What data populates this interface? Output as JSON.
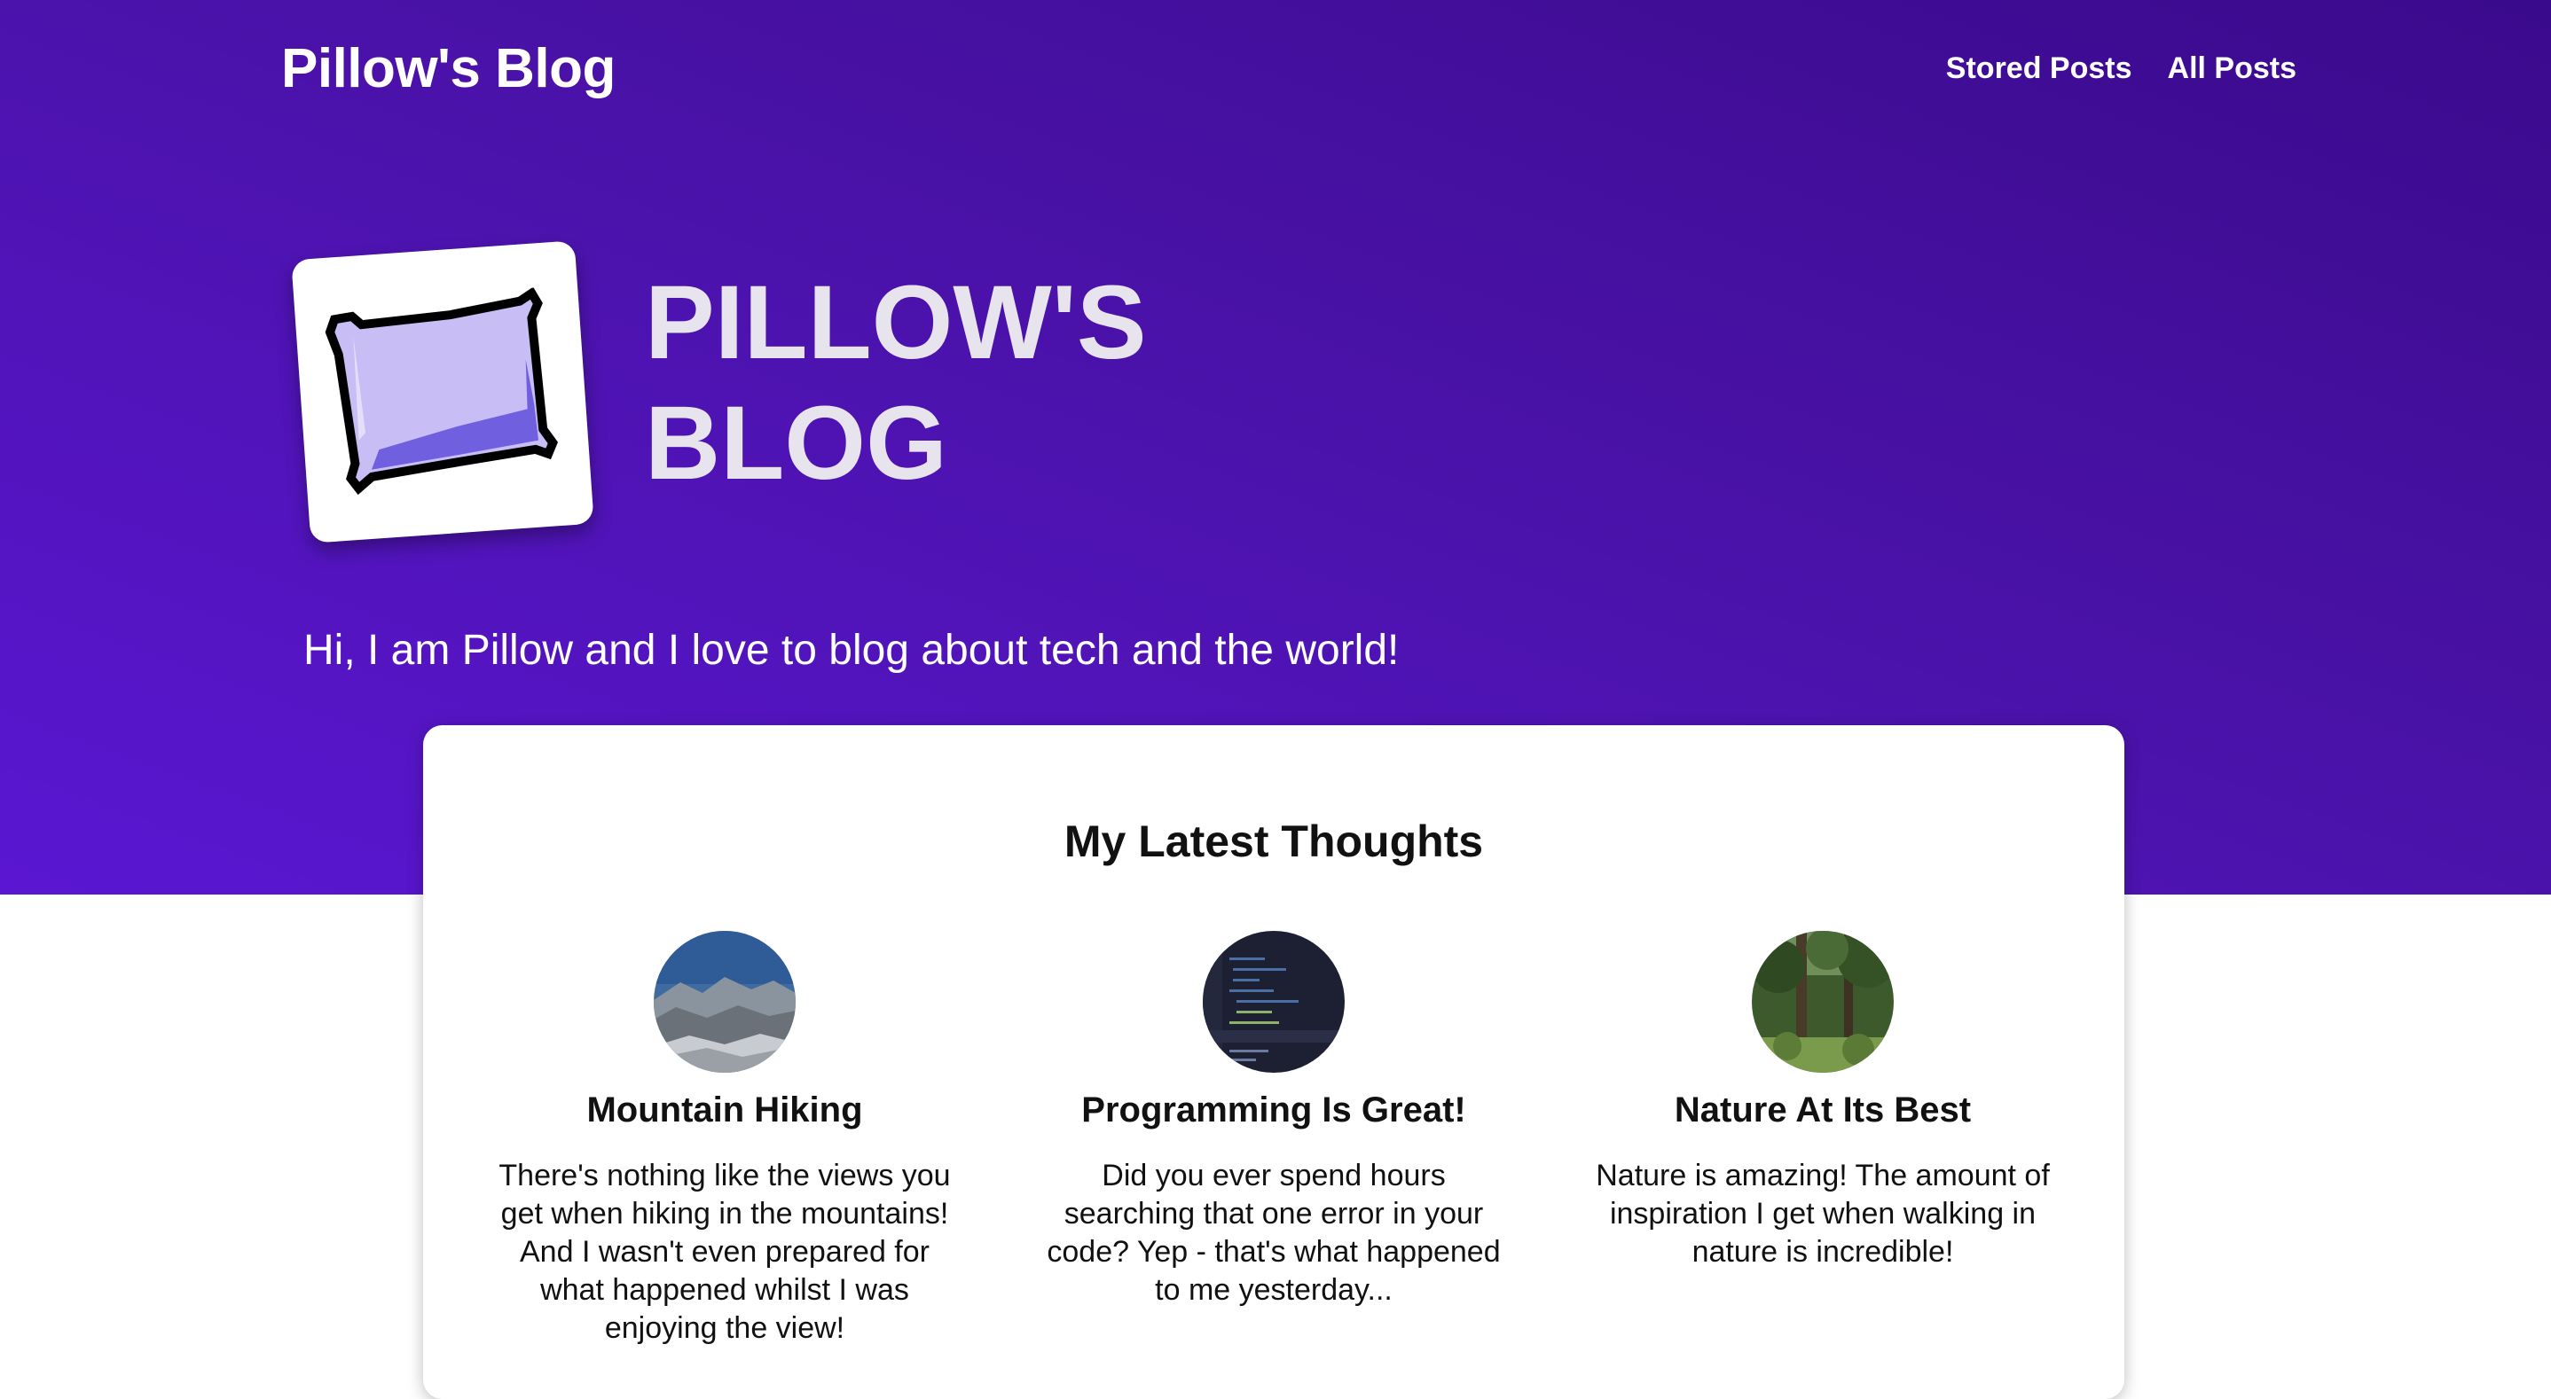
{
  "header": {
    "site_title": "Pillow's Blog",
    "nav": [
      {
        "label": "Stored Posts"
      },
      {
        "label": "All Posts"
      }
    ]
  },
  "hero": {
    "title": "PILLOW'S BLOG",
    "tagline": "Hi, I am Pillow and I love to blog about tech and the world!",
    "logo_icon": "pixel-pillow-icon"
  },
  "latest": {
    "heading": "My Latest Thoughts",
    "posts": [
      {
        "title": "Mountain Hiking",
        "excerpt": "There's nothing like the views you get when hiking in the mountains! And I wasn't even prepared for what happened whilst I was enjoying the view!",
        "image": "mountain-photo"
      },
      {
        "title": "Programming Is Great!",
        "excerpt": "Did you ever spend hours searching that one error in your code? Yep - that's what happened to me yesterday...",
        "image": "code-editor-photo"
      },
      {
        "title": "Nature At Its Best",
        "excerpt": "Nature is amazing! The amount of inspiration I get when walking in nature is incredible!",
        "image": "forest-photo"
      }
    ]
  },
  "colors": {
    "hero_dark": "#3a0a8c",
    "hero_light": "#5a16d2",
    "pillow_fill": "#c9bdf5",
    "pillow_shade": "#7060e0"
  }
}
